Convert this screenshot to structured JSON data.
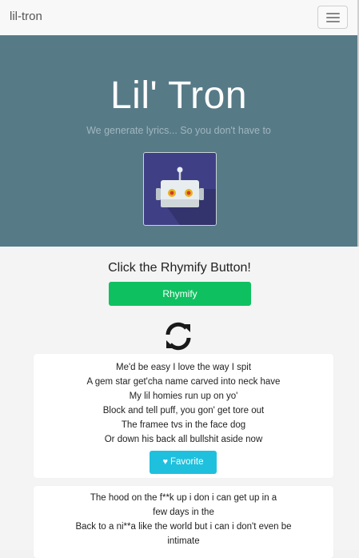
{
  "navbar": {
    "brand": "lil-tron"
  },
  "hero": {
    "title": "Lil' Tron",
    "subtitle": "We generate lyrics... So you don't have to"
  },
  "main": {
    "cta_label": "Click the Rhymify Button!",
    "rhymify_label": "Rhymify"
  },
  "cards": [
    {
      "lines": [
        "Me'd be easy I love the way I spit",
        "A gem star get'cha name carved into neck have",
        "My lil homies run up on yo'",
        "Block and tell puff, you gon' get tore out",
        "The framee tvs in the face dog",
        "Or down his back all bullshit aside now"
      ],
      "favorite_label": "Favorite"
    },
    {
      "lines": [
        "The hood on the f**k up i don i can get up in a",
        "few days in the",
        "Back to a ni**a like the world but i can i don't even be",
        "intimate"
      ]
    }
  ],
  "colors": {
    "hero_bg": "#577a87",
    "rhymify_green": "#0fc060",
    "favorite_cyan": "#1fc0dd",
    "robot_bg": "#3f3f86"
  }
}
